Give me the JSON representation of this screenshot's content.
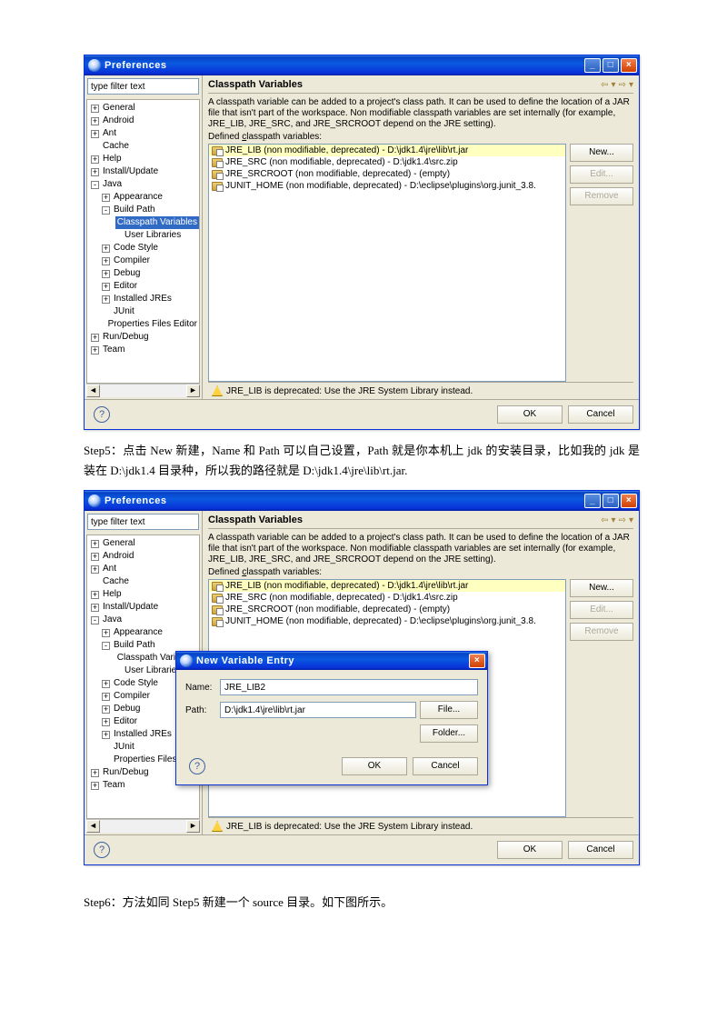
{
  "window_title": "Preferences",
  "filter_placeholder": "type filter text",
  "tree": {
    "general": "General",
    "android": "Android",
    "ant": "Ant",
    "cache": "Cache",
    "help": "Help",
    "install": "Install/Update",
    "java": "Java",
    "appearance": "Appearance",
    "build_path": "Build Path",
    "cp_vars": "Classpath Variables",
    "user_libs": "User Libraries",
    "code_style": "Code Style",
    "compiler": "Compiler",
    "debug": "Debug",
    "editor": "Editor",
    "installed_jres": "Installed JREs",
    "junit": "JUnit",
    "prop_files": "Properties Files Editor",
    "prop_files_short": "Properties Files Ed",
    "run_debug": "Run/Debug",
    "team": "Team"
  },
  "content": {
    "title": "Classpath Variables",
    "desc": "A classpath variable can be added to a project's class path. It can be used to define the location of a JAR file that isn't part of the workspace. Non modifiable classpath variables are set internally (for example, JRE_LIB, JRE_SRC, and JRE_SRCROOT depend on the JRE setting).",
    "defined_label_pre": "Defined ",
    "defined_label_u": "c",
    "defined_label_post": "lasspath variables:",
    "vars": {
      "v0": "JRE_LIB (non modifiable, deprecated) - D:\\jdk1.4\\jre\\lib\\rt.jar",
      "v1": "JRE_SRC (non modifiable, deprecated) - D:\\jdk1.4\\src.zip",
      "v2": "JRE_SRCROOT (non modifiable, deprecated) - (empty)",
      "v3": "JUNIT_HOME (non modifiable, deprecated) - D:\\eclipse\\plugins\\org.junit_3.8."
    },
    "btn_new": "New...",
    "btn_edit": "Edit...",
    "btn_remove": "Remove",
    "warn": "JRE_LIB is deprecated: Use the JRE System Library instead."
  },
  "footer": {
    "help": "?",
    "ok": "OK",
    "cancel": "Cancel"
  },
  "step5": "Step5：点击 New 新建，Name 和 Path 可以自己设置，Path 就是你本机上 jdk 的安装目录，比如我的 jdk 是装在 D:\\jdk1.4 目录种，所以我的路径就是 D:\\jdk1.4\\jre\\lib\\rt.jar.",
  "step6": "Step6：方法如同 Step5 新建一个 source 目录。如下图所示。",
  "dialog": {
    "title": "New Variable Entry",
    "name_label": "Name:",
    "name_value": "JRE_LIB2",
    "path_label": "Path:",
    "path_value": "D:\\jdk1.4\\jre\\lib\\rt.jar",
    "btn_file": "File...",
    "btn_folder": "Folder...",
    "ok": "OK",
    "cancel": "Cancel"
  },
  "winbtns": {
    "min": "_",
    "max": "□",
    "close": "×"
  }
}
